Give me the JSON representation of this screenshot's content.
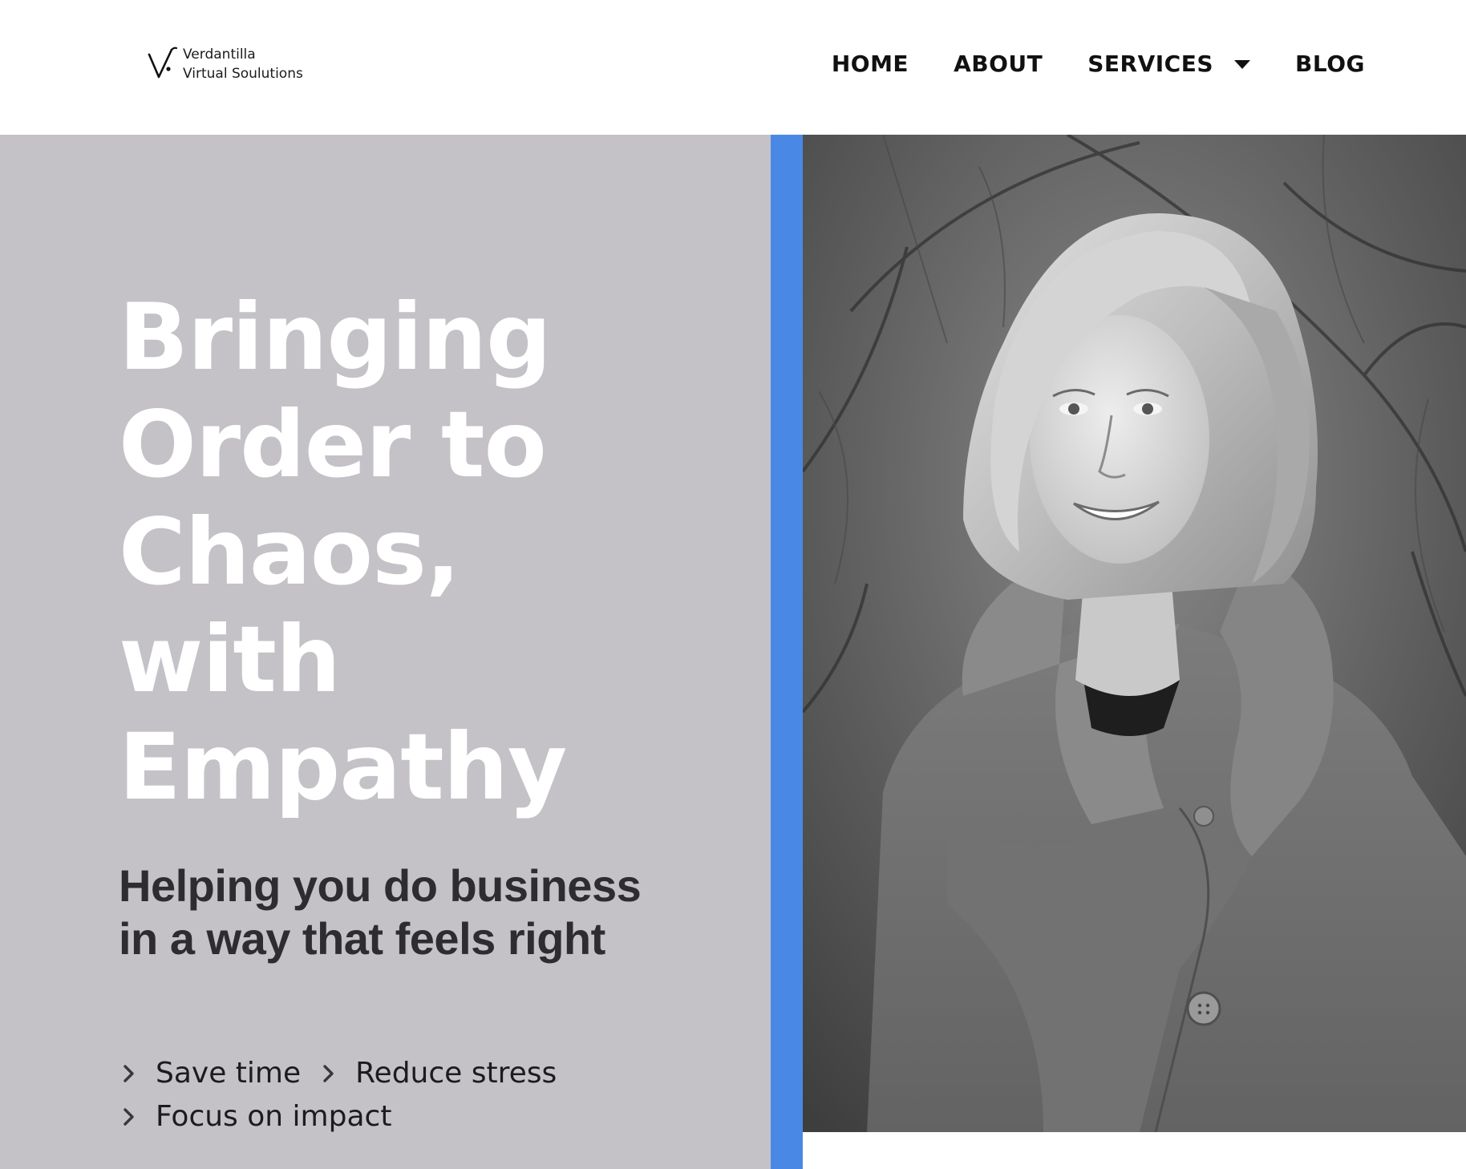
{
  "logo": {
    "line1": "Verdantilla",
    "line2": "Virtual Soulutions"
  },
  "nav": {
    "items": [
      {
        "label": "HOME"
      },
      {
        "label": "ABOUT"
      },
      {
        "label": "SERVICES",
        "has_dropdown": true
      },
      {
        "label": "BLOG"
      }
    ]
  },
  "hero": {
    "headline_lines": [
      "Bringing",
      "Order to",
      "Chaos,",
      "with",
      "Empathy"
    ],
    "subheadline": "Helping you do business in a way that feels right",
    "benefits": [
      "Save time",
      "Reduce stress",
      "Focus on impact"
    ],
    "image_icon": "portrait-photo-icon"
  },
  "colors": {
    "accent": "#4a88e5",
    "panel": "#c4c2c6",
    "headline": "#ffffff",
    "subheadline": "#2f2c31"
  }
}
